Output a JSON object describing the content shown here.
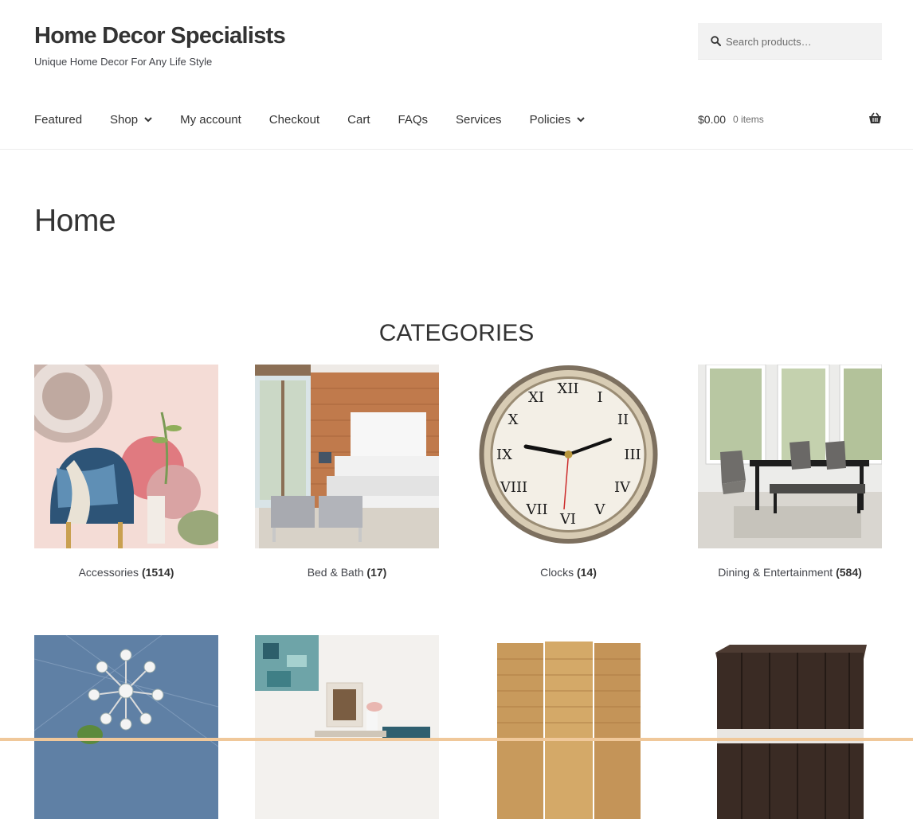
{
  "site": {
    "title": "Home Decor Specialists",
    "tagline": "Unique Home Decor For Any Life Style"
  },
  "search": {
    "placeholder": "Search products…"
  },
  "nav": {
    "items": [
      {
        "label": "Featured",
        "has_dropdown": false
      },
      {
        "label": "Shop",
        "has_dropdown": true
      },
      {
        "label": "My account",
        "has_dropdown": false
      },
      {
        "label": "Checkout",
        "has_dropdown": false
      },
      {
        "label": "Cart",
        "has_dropdown": false
      },
      {
        "label": "FAQs",
        "has_dropdown": false
      },
      {
        "label": "Services",
        "has_dropdown": false
      },
      {
        "label": "Policies",
        "has_dropdown": true
      }
    ]
  },
  "cart": {
    "amount": "$0.00",
    "count": "0 items",
    "icon": "basket-icon"
  },
  "page": {
    "title": "Home"
  },
  "categories_section": {
    "title": "CATEGORIES",
    "items": [
      {
        "name": "Accessories",
        "count": "(1514)",
        "image": "accessories-photo"
      },
      {
        "name": "Bed & Bath",
        "count": "(17)",
        "image": "bedroom-photo"
      },
      {
        "name": "Clocks",
        "count": "(14)",
        "image": "clock-photo"
      },
      {
        "name": "Dining & Entertainment",
        "count": "(584)",
        "image": "dining-photo"
      },
      {
        "name": "",
        "count": "",
        "image": "chandelier-photo"
      },
      {
        "name": "",
        "count": "",
        "image": "wall-art-photo"
      },
      {
        "name": "",
        "count": "",
        "image": "room-divider-photo"
      },
      {
        "name": "",
        "count": "",
        "image": "wood-stool-photo"
      }
    ]
  },
  "colors": {
    "text": "#43454b",
    "heading": "#333333",
    "search_bg": "#f2f2f2",
    "bottom_bar": "#f0c89a"
  }
}
